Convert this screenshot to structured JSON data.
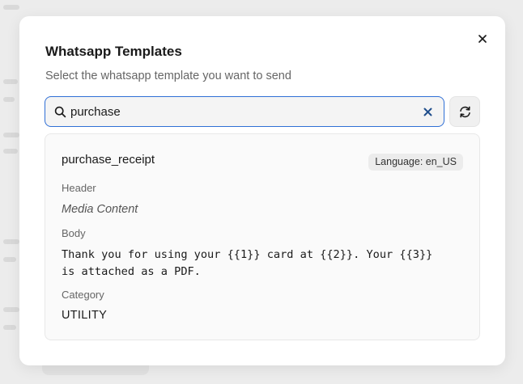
{
  "modal": {
    "title": "Whatsapp Templates",
    "subtitle": "Select the whatsapp template you want to send",
    "close_icon": "close-icon"
  },
  "search": {
    "value": "purchase",
    "icon": "search-icon",
    "clear_icon": "clear-icon",
    "focus_color": "#2f6fd6"
  },
  "refresh": {
    "icon": "refresh-icon"
  },
  "template": {
    "name": "purchase_receipt",
    "language_badge": "Language: en_US",
    "header_label": "Header",
    "header_value": "Media Content",
    "body_label": "Body",
    "body_value": "Thank you for using your {{1}} card at {{2}}. Your {{3}}\nis attached as a PDF.",
    "category_label": "Category",
    "category_value": "UTILITY"
  }
}
